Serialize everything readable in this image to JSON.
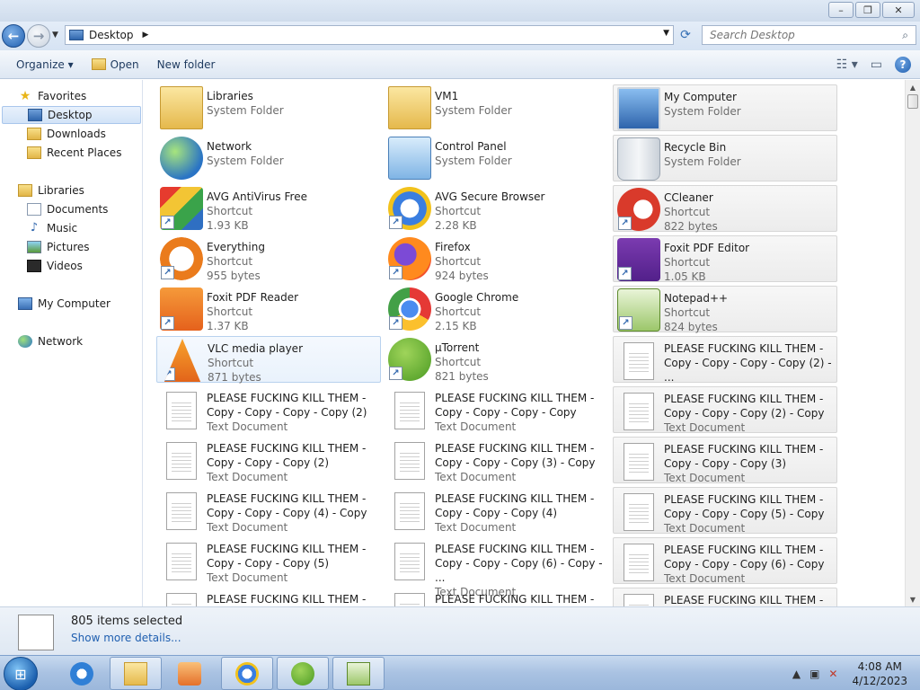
{
  "window": {
    "buttons": {
      "minimize": "–",
      "maximize": "❐",
      "close": "✕"
    }
  },
  "address": {
    "location": "Desktop",
    "search_placeholder": "Search Desktop"
  },
  "toolbar": {
    "organize": "Organize ▾",
    "open": "Open",
    "new_folder": "New folder"
  },
  "nav": {
    "favorites": "Favorites",
    "desktop": "Desktop",
    "downloads": "Downloads",
    "recent_places": "Recent Places",
    "libraries": "Libraries",
    "documents": "Documents",
    "music": "Music",
    "pictures": "Pictures",
    "videos": "Videos",
    "my_computer": "My Computer",
    "network": "Network"
  },
  "items": [
    {
      "name": "Libraries",
      "sub1": "System Folder",
      "sub2": "",
      "icon": "libraries-icon"
    },
    {
      "name": "VM1",
      "sub1": "System Folder",
      "sub2": "",
      "icon": "user-folder-icon"
    },
    {
      "name": "My Computer",
      "sub1": "System Folder",
      "sub2": "",
      "icon": "computer-icon"
    },
    {
      "name": "Network",
      "sub1": "System Folder",
      "sub2": "",
      "icon": "network-icon"
    },
    {
      "name": "Control Panel",
      "sub1": "System Folder",
      "sub2": "",
      "icon": "control-panel-icon"
    },
    {
      "name": "Recycle Bin",
      "sub1": "System Folder",
      "sub2": "",
      "icon": "recycle-bin-icon"
    },
    {
      "name": "AVG AntiVirus Free",
      "sub1": "Shortcut",
      "sub2": "1.93 KB",
      "icon": "avg-antivirus-icon"
    },
    {
      "name": "AVG Secure Browser",
      "sub1": "Shortcut",
      "sub2": "2.28 KB",
      "icon": "avg-browser-icon"
    },
    {
      "name": "CCleaner",
      "sub1": "Shortcut",
      "sub2": "822 bytes",
      "icon": "ccleaner-icon"
    },
    {
      "name": "Everything",
      "sub1": "Shortcut",
      "sub2": "955 bytes",
      "icon": "everything-icon"
    },
    {
      "name": "Firefox",
      "sub1": "Shortcut",
      "sub2": "924 bytes",
      "icon": "firefox-icon"
    },
    {
      "name": "Foxit PDF Editor",
      "sub1": "Shortcut",
      "sub2": "1.05 KB",
      "icon": "foxit-editor-icon"
    },
    {
      "name": "Foxit PDF Reader",
      "sub1": "Shortcut",
      "sub2": "1.37 KB",
      "icon": "foxit-reader-icon"
    },
    {
      "name": "Google Chrome",
      "sub1": "Shortcut",
      "sub2": "2.15 KB",
      "icon": "chrome-icon"
    },
    {
      "name": "Notepad++",
      "sub1": "Shortcut",
      "sub2": "824 bytes",
      "icon": "notepadpp-icon"
    },
    {
      "name": "VLC media player",
      "sub1": "Shortcut",
      "sub2": "871 bytes",
      "icon": "vlc-icon"
    },
    {
      "name": "µTorrent",
      "sub1": "Shortcut",
      "sub2": "821 bytes",
      "icon": "utorrent-icon"
    },
    {
      "name": "PLEASE FUCKING KILL THEM -",
      "sub1": "Copy - Copy - Copy - Copy (2) - ...",
      "sub2": "Text Document",
      "icon": "text-document-icon"
    },
    {
      "name": "PLEASE FUCKING KILL THEM -",
      "sub1": "Copy - Copy - Copy - Copy (2)",
      "sub2": "Text Document",
      "icon": "text-document-icon"
    },
    {
      "name": "PLEASE FUCKING KILL THEM -",
      "sub1": "Copy - Copy - Copy - Copy",
      "sub2": "Text Document",
      "icon": "text-document-icon"
    },
    {
      "name": "PLEASE FUCKING KILL THEM -",
      "sub1": "Copy - Copy - Copy (2) - Copy",
      "sub2": "Text Document",
      "icon": "text-document-icon"
    },
    {
      "name": "PLEASE FUCKING KILL THEM -",
      "sub1": "Copy - Copy - Copy (2)",
      "sub2": "Text Document",
      "icon": "text-document-icon"
    },
    {
      "name": "PLEASE FUCKING KILL THEM -",
      "sub1": "Copy - Copy - Copy (3) - Copy",
      "sub2": "Text Document",
      "icon": "text-document-icon"
    },
    {
      "name": "PLEASE FUCKING KILL THEM -",
      "sub1": "Copy - Copy - Copy (3)",
      "sub2": "Text Document",
      "icon": "text-document-icon"
    },
    {
      "name": "PLEASE FUCKING KILL THEM -",
      "sub1": "Copy - Copy - Copy (4) - Copy",
      "sub2": "Text Document",
      "icon": "text-document-icon"
    },
    {
      "name": "PLEASE FUCKING KILL THEM -",
      "sub1": "Copy - Copy - Copy (4)",
      "sub2": "Text Document",
      "icon": "text-document-icon"
    },
    {
      "name": "PLEASE FUCKING KILL THEM -",
      "sub1": "Copy - Copy - Copy (5) - Copy",
      "sub2": "Text Document",
      "icon": "text-document-icon"
    },
    {
      "name": "PLEASE FUCKING KILL THEM -",
      "sub1": "Copy - Copy - Copy (5)",
      "sub2": "Text Document",
      "icon": "text-document-icon"
    },
    {
      "name": "PLEASE FUCKING KILL THEM -",
      "sub1": "Copy - Copy - Copy (6) - Copy - ...",
      "sub2": "Text Document",
      "icon": "text-document-icon"
    },
    {
      "name": "PLEASE FUCKING KILL THEM -",
      "sub1": "Copy - Copy - Copy (6) - Copy",
      "sub2": "Text Document",
      "icon": "text-document-icon"
    },
    {
      "name": "PLEASE FUCKING KILL THEM -",
      "sub1": "",
      "sub2": "",
      "icon": "text-document-icon"
    },
    {
      "name": "PLEASE FUCKING KILL THEM -",
      "sub1": "",
      "sub2": "",
      "icon": "text-document-icon"
    },
    {
      "name": "PLEASE FUCKING KILL THEM -",
      "sub1": "",
      "sub2": "",
      "icon": "text-document-icon"
    }
  ],
  "details": {
    "count": "805 items selected",
    "more": "Show more details..."
  },
  "taskbar": {
    "apps": [
      "internet-explorer-icon",
      "windows-explorer-icon",
      "media-player-icon",
      "avg-browser-icon",
      "utorrent-icon",
      "notepadpp-icon"
    ],
    "time": "4:08 AM",
    "date": "4/12/2023"
  }
}
